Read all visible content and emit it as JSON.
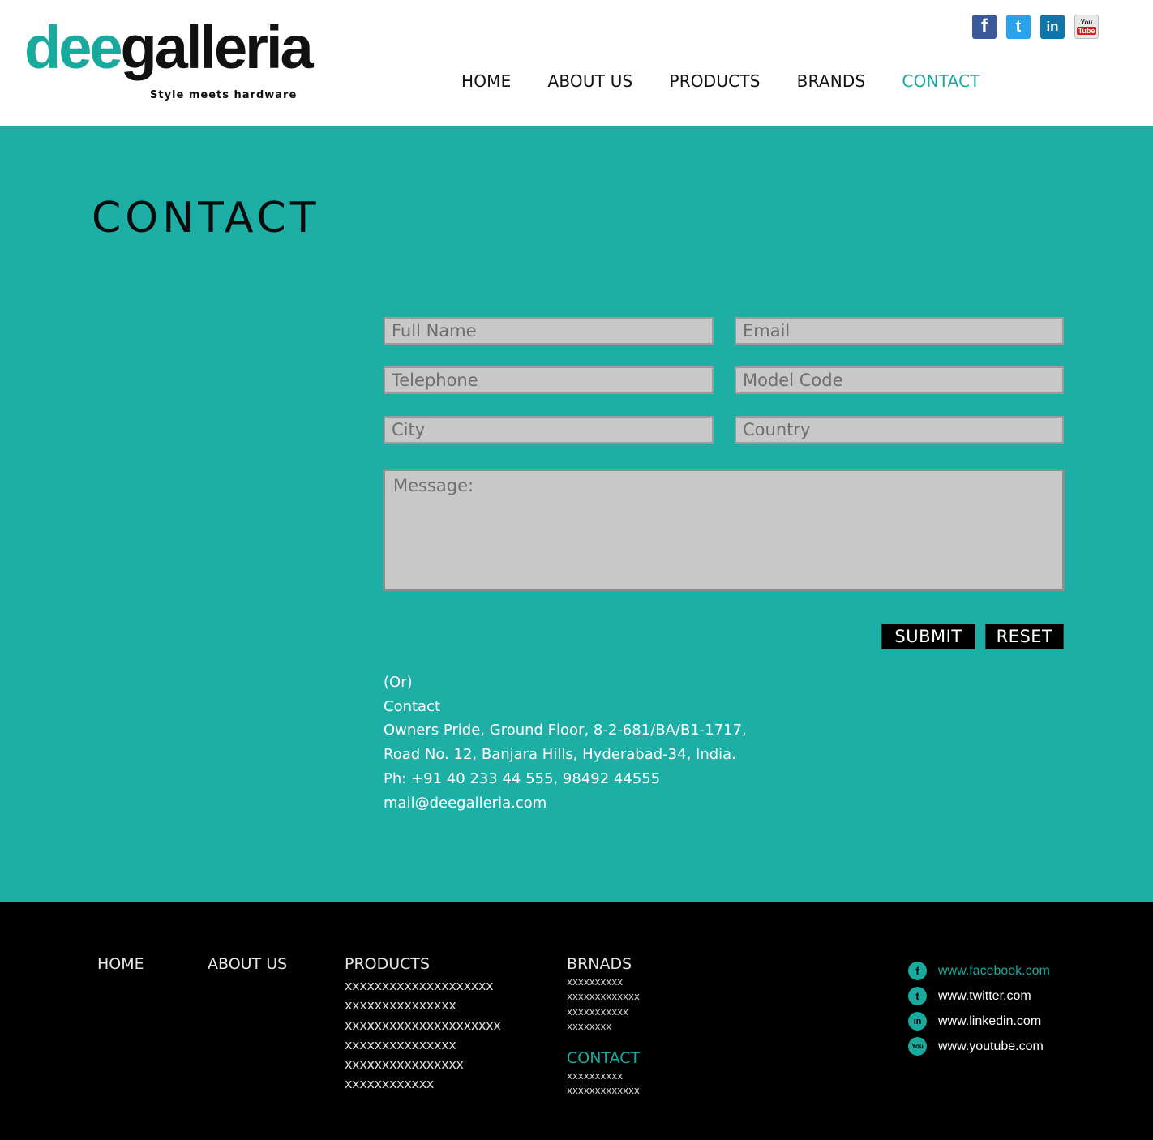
{
  "brand": {
    "logo_part1": "dee",
    "logo_part2": "galleria",
    "tagline": "Style meets hardware",
    "teal": "#1daea5",
    "accent": "#1aa99d"
  },
  "header": {
    "social": [
      {
        "name": "facebook-icon",
        "glyph": "f"
      },
      {
        "name": "twitter-icon",
        "glyph": "t"
      },
      {
        "name": "linkedin-icon",
        "glyph": "in"
      },
      {
        "name": "youtube-icon",
        "glyph_top": "You",
        "glyph_bottom": "Tube"
      }
    ],
    "nav": [
      "HOME",
      "ABOUT US",
      "PRODUCTS",
      "BRANDS",
      "CONTACT"
    ],
    "active_nav": "CONTACT"
  },
  "main": {
    "title": "CONTACT",
    "form": {
      "full_name_placeholder": "Full Name",
      "email_placeholder": "Email",
      "telephone_placeholder": "Telephone",
      "model_code_placeholder": "Model Code",
      "city_placeholder": "City",
      "country_placeholder": "Country",
      "message_placeholder": "Message:",
      "submit_label": "SUBMIT",
      "reset_label": "RESET"
    },
    "alt_contact": {
      "or": "(Or)",
      "heading": "Contact",
      "address_line1": "Owners Pride, Ground Floor, 8-2-681/BA/B1-1717,",
      "address_line2": "Road No. 12, Banjara Hills, Hyderabad-34, India.",
      "phone": "Ph: +91 40 233 44 555, 98492 44555",
      "email": "mail@deegalleria.com"
    }
  },
  "footer": {
    "home": "HOME",
    "about": "ABOUT US",
    "products": "PRODUCTS",
    "products_items": [
      "xxxxxxxxxxxxxxxxxxxx",
      "xxxxxxxxxxxxxxx",
      "xxxxxxxxxxxxxxxxxxxxx",
      "xxxxxxxxxxxxxxx",
      "xxxxxxxxxxxxxxxx",
      "xxxxxxxxxxxx"
    ],
    "brands": "BRNADS",
    "brands_items": [
      "xxxxxxxxxx",
      "xxxxxxxxxxxxx",
      "xxxxxxxxxxx",
      "xxxxxxxx"
    ],
    "contact": "CONTACT",
    "contact_items": [
      "xxxxxxxxxx",
      "xxxxxxxxxxxxx"
    ],
    "social_links": [
      {
        "icon": "facebook-icon",
        "glyph": "f",
        "label": "www.facebook.com"
      },
      {
        "icon": "twitter-icon",
        "glyph": "t",
        "label": "www.twitter.com"
      },
      {
        "icon": "linkedin-icon",
        "glyph": "in",
        "label": "www.linkedin.com"
      },
      {
        "icon": "youtube-icon",
        "glyph": "You",
        "label": "www.youtube.com"
      }
    ]
  }
}
